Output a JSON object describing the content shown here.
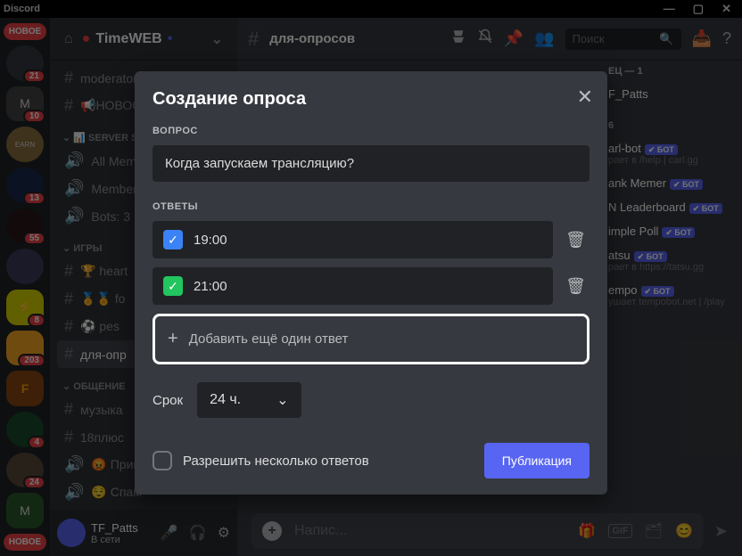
{
  "titlebar": {
    "app": "Discord"
  },
  "server": {
    "name": "TimeWEB"
  },
  "pills": {
    "new": "НОВОЕ",
    "count": "21"
  },
  "server_icons": [
    {
      "badge": "10"
    },
    {
      "label": "EARN"
    },
    {
      "badge": ""
    },
    {
      "badge": "13"
    },
    {
      "badge": "55"
    },
    {
      "badge": ""
    },
    {
      "badge": ""
    },
    {
      "badge": "8"
    },
    {
      "badge": "203"
    },
    {
      "label": "F"
    },
    {
      "badge": "4"
    },
    {
      "badge": "24"
    },
    {
      "label": "M"
    }
  ],
  "categories": [
    {
      "name": "",
      "channels": [
        {
          "icon": "#",
          "name": "moderator-only"
        },
        {
          "icon": "#",
          "name": "📢НОВОСТ"
        }
      ]
    },
    {
      "name": "📊 SERVER STATS",
      "channels": [
        {
          "icon": "🔊",
          "name": "All Members"
        },
        {
          "icon": "🔊",
          "name": "Members"
        },
        {
          "icon": "🔊",
          "name": "Bots: 3"
        }
      ]
    },
    {
      "name": "ИГРЫ",
      "channels": [
        {
          "icon": "#",
          "name": "🏆 heart"
        },
        {
          "icon": "#",
          "name": "🏅🏅 fo"
        },
        {
          "icon": "#",
          "name": "⚽ pes"
        },
        {
          "icon": "#",
          "name": "для-опр",
          "active": true
        }
      ]
    },
    {
      "name": "ОБЩЕНИЕ",
      "channels": [
        {
          "icon": "#",
          "name": "музыка"
        },
        {
          "icon": "#",
          "name": "18плюс"
        },
        {
          "icon": "🔊",
          "name": "😡 Прив"
        },
        {
          "icon": "🔊",
          "name": "😌 Спам"
        }
      ]
    }
  ],
  "user": {
    "name": "TF_Patts",
    "status": "В сети"
  },
  "chat": {
    "channel": "для-опросов",
    "search": "Поиск",
    "input": "Напис..."
  },
  "modal": {
    "title": "Создание опроса",
    "question_label": "ВОПРОС",
    "question": "Когда запускаем трансляцию?",
    "answers_label": "ОТВЕТЫ",
    "answers": [
      {
        "emoji": "✓",
        "text": "19:00"
      },
      {
        "emoji": "✓",
        "text": "21:00"
      }
    ],
    "add_answer": "Добавить ещё один ответ",
    "duration_label": "Срок",
    "duration_value": "24 ч.",
    "allow_multiple": "Разрешить несколько ответов",
    "publish": "Публикация"
  },
  "members": {
    "header": "ЕЦ — 1",
    "owner": "F_Patts",
    "count_label": "6",
    "list": [
      {
        "name": "arl-bot",
        "bot": true,
        "sub": "рает в /help | carl.gg"
      },
      {
        "name": "ank Memer",
        "bot": true,
        "sub": ""
      },
      {
        "name": "N Leaderboard",
        "bot": true,
        "sub": ""
      },
      {
        "name": "imple Poll",
        "bot": true,
        "sub": ""
      },
      {
        "name": "atsu",
        "bot": true,
        "sub": "рает в https://tatsu.gg"
      },
      {
        "name": "empo",
        "bot": true,
        "sub": "ушает tempobot.net | /play"
      }
    ],
    "bot_label": "✔ БОТ"
  }
}
